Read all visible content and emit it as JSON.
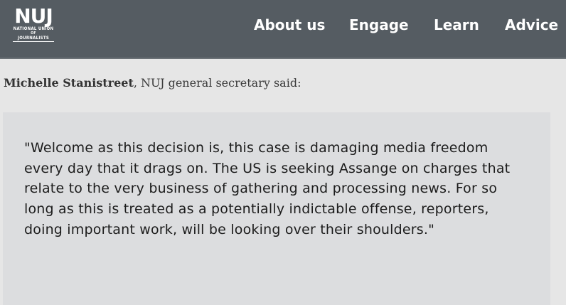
{
  "logo": {
    "mark": "NUJ",
    "line1": "NATIONAL UNION",
    "line2": "OF",
    "line3": "JOURNALISTS"
  },
  "nav": {
    "items": [
      {
        "label": "About us"
      },
      {
        "label": "Engage"
      },
      {
        "label": "Learn"
      },
      {
        "label": "Advice"
      }
    ]
  },
  "intro": {
    "name": "Michelle Stanistreet",
    "text": ", NUJ general secretary said:"
  },
  "quote": {
    "text": "\"Welcome as this decision is, this case is damaging media freedom every day that it drags on. The US is seeking Assange on charges that relate to the very business of gathering and processing news. For so long as this is treated as a potentially indictable offense, reporters, doing important work, will be looking over their shoulders.\""
  },
  "colors": {
    "header_bg": "#555c62",
    "page_bg": "#e6e6e6",
    "quote_bg": "#dcdddf",
    "text": "#1c1c1c"
  }
}
